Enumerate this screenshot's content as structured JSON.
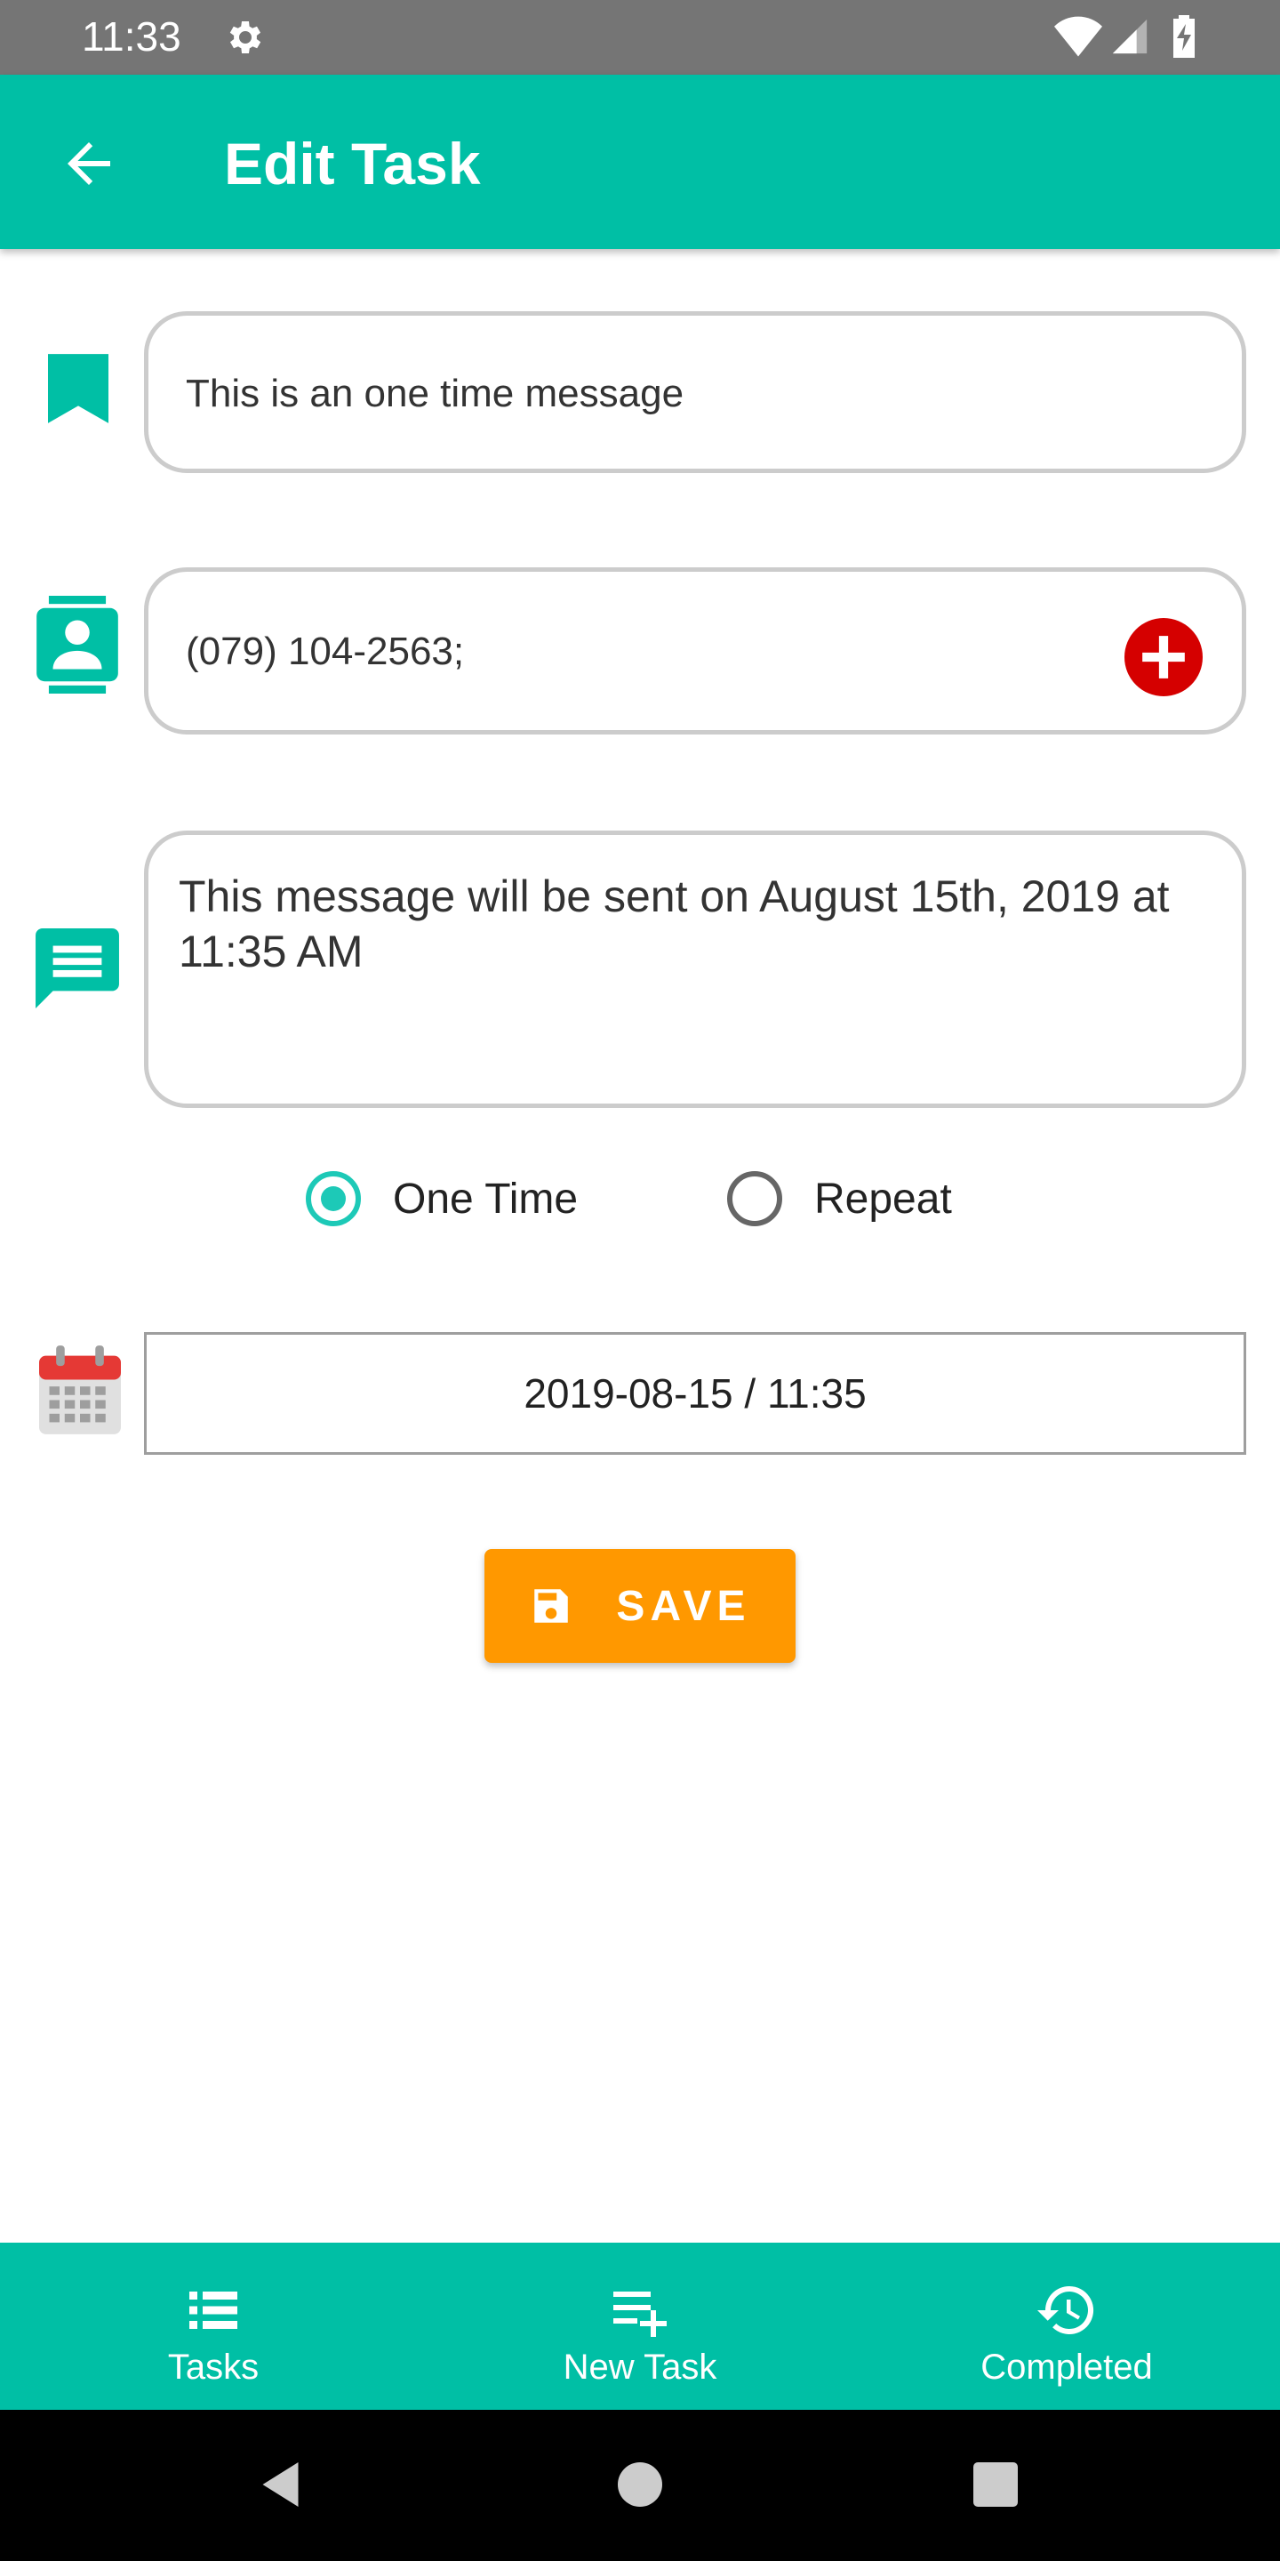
{
  "status_bar": {
    "time": "11:33"
  },
  "app_bar": {
    "title": "Edit Task"
  },
  "form": {
    "task_name": "This is an one time message",
    "contacts": "(079) 104-2563;",
    "message": "This message will be sent on August 15th, 2019 at 11:35 AM",
    "schedule": {
      "options": [
        "One Time",
        "Repeat"
      ],
      "selected": "One Time"
    },
    "datetime": "2019-08-15 / 11:35",
    "save_label": "SAVE"
  },
  "bottom_nav": {
    "items": [
      {
        "label": "Tasks",
        "icon": "list-icon"
      },
      {
        "label": "New Task",
        "icon": "playlist-add-icon"
      },
      {
        "label": "Completed",
        "icon": "history-icon"
      }
    ]
  },
  "colors": {
    "primary": "#00BFA5",
    "accent_button": "#FF9800",
    "add_button": "#D50000",
    "radio_selected": "#1DC9B7",
    "status_bar": "#757575"
  }
}
